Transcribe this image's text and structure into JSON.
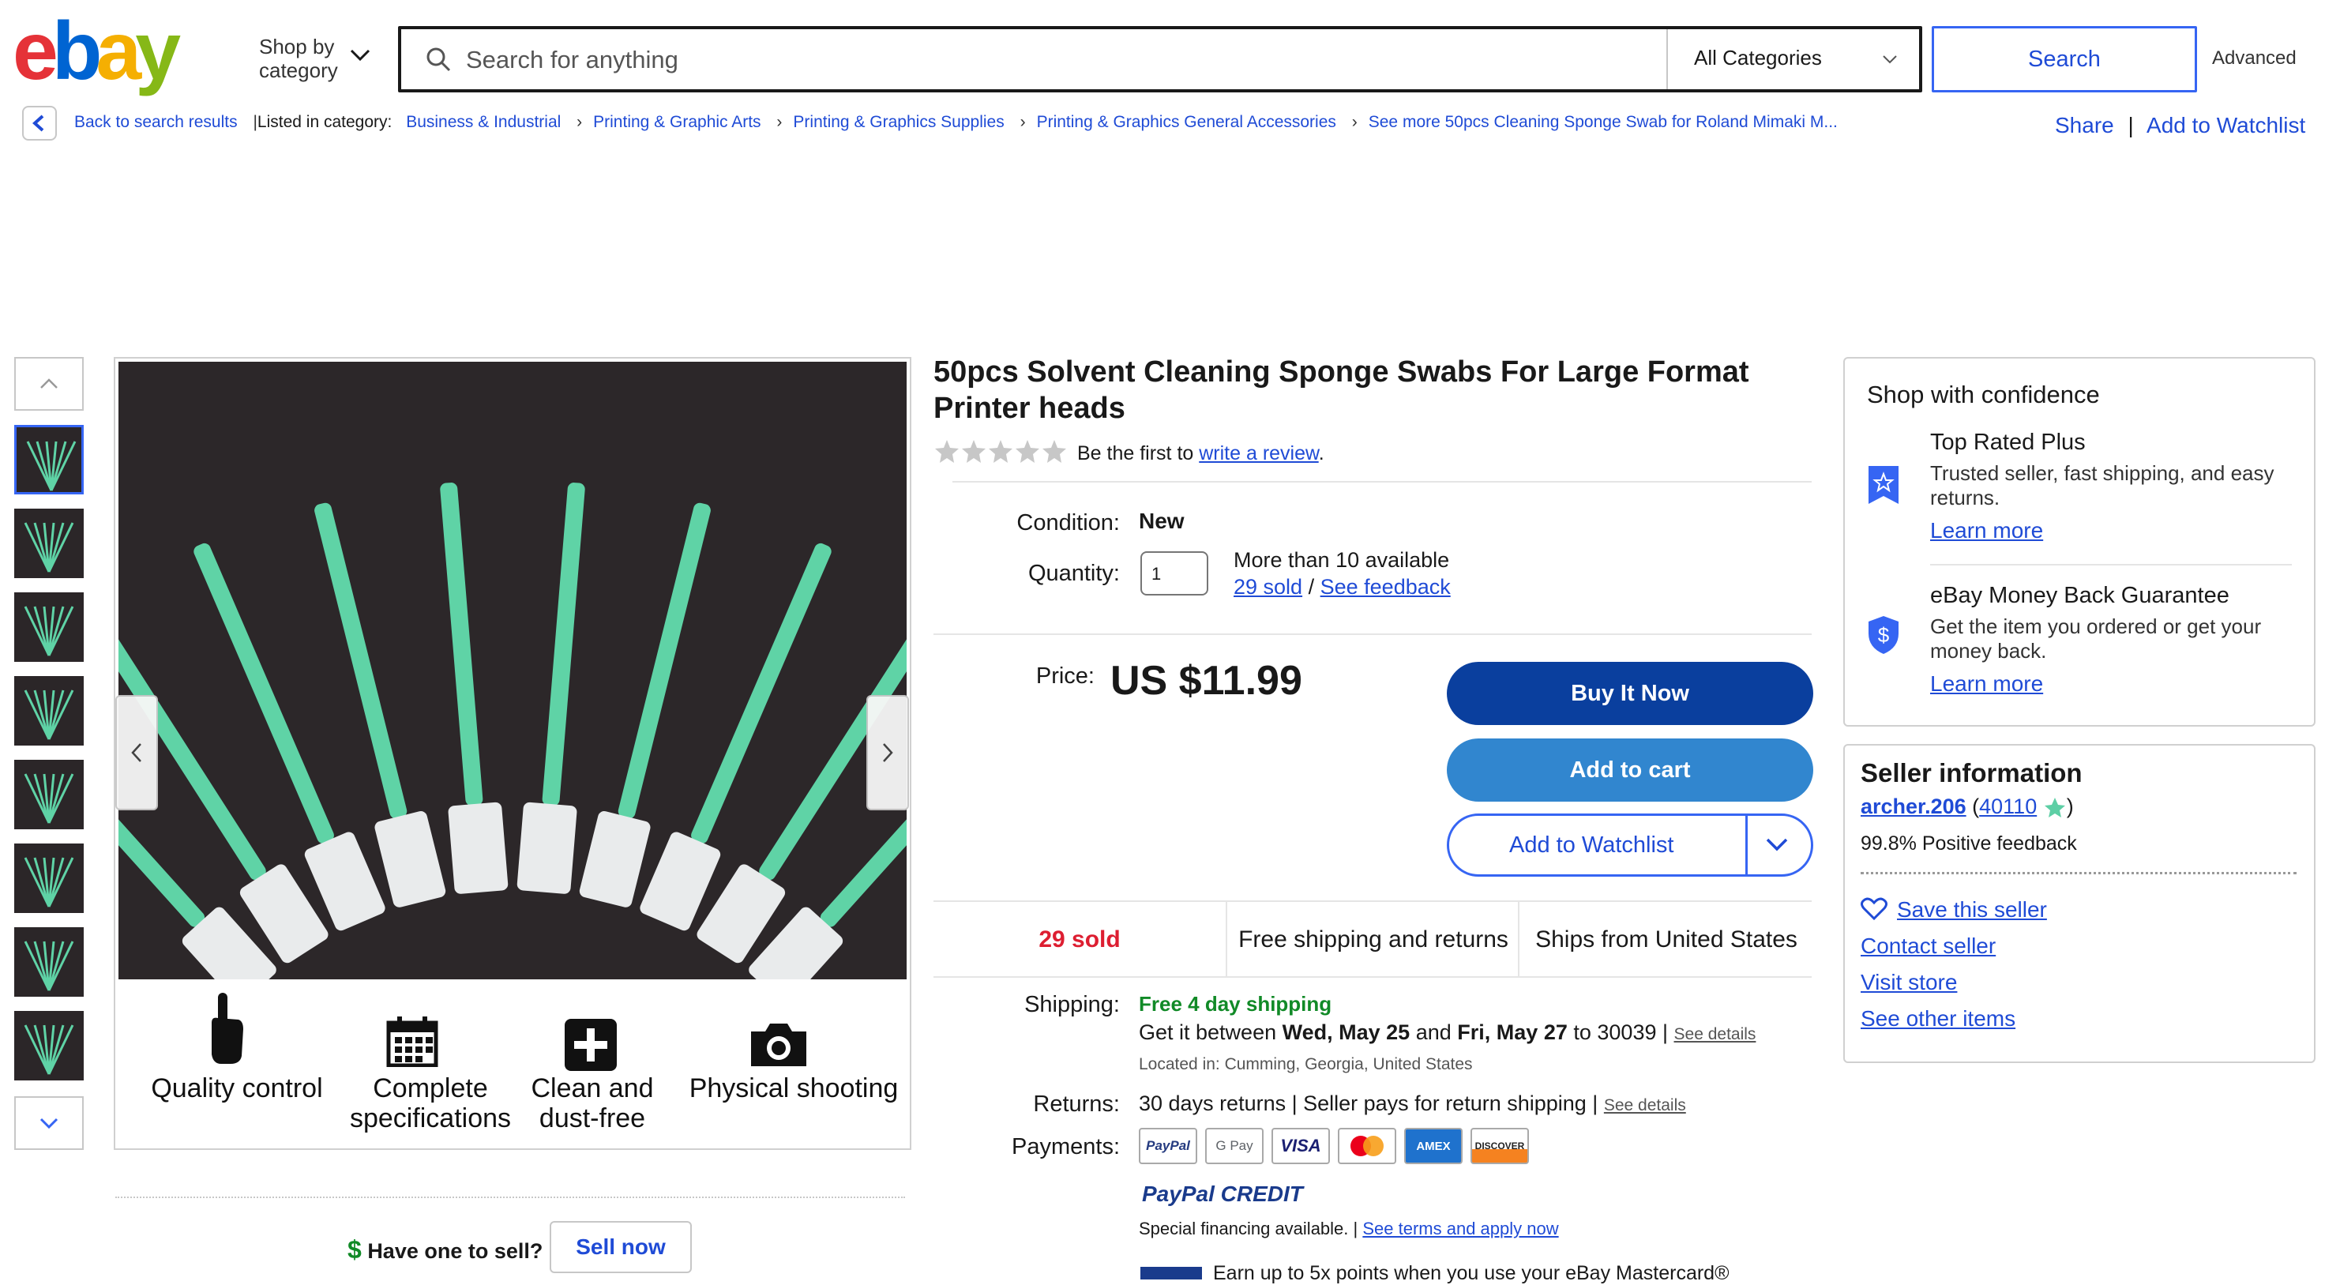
{
  "header": {
    "logo_text": "ebay",
    "shop_by_category": "Shop by category",
    "search_placeholder": "Search for anything",
    "category_select": "All Categories",
    "search_button": "Search",
    "advanced_link": "Advanced"
  },
  "breadcrumb": {
    "back": "Back to search results",
    "listed_in": "Listed in category:",
    "items": [
      "Business & Industrial",
      "Printing & Graphic Arts",
      "Printing & Graphics Supplies",
      "Printing & Graphics General Accessories",
      "See more 50pcs Cleaning Sponge Swab for Roland Mimaki M..."
    ],
    "share": "Share",
    "add_to_watchlist": "Add to Watchlist"
  },
  "gallery": {
    "thumbnail_count": 8,
    "selected_index": 0,
    "features": [
      "Quality control",
      "Complete specifications",
      "Clean and dust-free",
      "Physical shooting"
    ],
    "sell_question": "Have one to sell?",
    "sell_now": "Sell now"
  },
  "product": {
    "title": "50pcs Solvent Cleaning Sponge Swabs For Large Format Printer heads",
    "review_prompt": "Be the first to",
    "review_link": "write a review",
    "review_period": ".",
    "condition_label": "Condition:",
    "condition_value": "New",
    "quantity_label": "Quantity:",
    "quantity_value": "1",
    "availability": "More than 10 available",
    "sold_link": "29 sold",
    "slash": "/",
    "feedback_link": "See feedback",
    "price_label": "Price:",
    "price": "US $11.99",
    "buy_it_now": "Buy It Now",
    "add_to_cart": "Add to cart",
    "add_to_watchlist": "Add to Watchlist",
    "highlights": [
      "29 sold",
      "Free shipping and returns",
      "Ships from United States"
    ],
    "shipping_label": "Shipping:",
    "shipping_free": "Free 4 day shipping",
    "delivery_pre": "Get it between",
    "delivery_start": "Wed, May 25",
    "delivery_and": "and",
    "delivery_end": "Fri, May 27",
    "delivery_zip": "to 30039 |",
    "see_details": "See details",
    "located_in": "Located in: Cumming, Georgia, United States",
    "returns_label": "Returns:",
    "returns_value": "30 days returns | Seller pays for return shipping |",
    "payments_label": "Payments:",
    "payment_methods": [
      "PayPal",
      "G Pay",
      "VISA",
      "Mastercard",
      "AMEX",
      "DISCOVER"
    ],
    "paypal_credit": "PayPal CREDIT",
    "financing_text": "Special financing available. |",
    "financing_link": "See terms and apply now",
    "mastercard_promo": "Earn up to 5x points when you use your eBay Mastercard®"
  },
  "confidence": {
    "title": "Shop with confidence",
    "items": [
      {
        "heading": "Top Rated Plus",
        "text": "Trusted seller, fast shipping, and easy returns.",
        "link": "Learn more"
      },
      {
        "heading": "eBay Money Back Guarantee",
        "text": "Get the item you ordered or get your money back.",
        "link": "Learn more"
      }
    ]
  },
  "seller": {
    "title": "Seller information",
    "name": "archer.206",
    "feedback_score": "40110",
    "positive": "99.8% Positive feedback",
    "save_seller": "Save this seller",
    "contact": "Contact seller",
    "visit_store": "Visit store",
    "other_items": "See other items"
  },
  "colors": {
    "ebay_red": "#e53238",
    "ebay_blue": "#0064d2",
    "ebay_yellow": "#f5af02",
    "ebay_green": "#86b817",
    "link": "#1f4bd6",
    "buy_now": "#0a3f9e",
    "add_to_cart": "#3186cf",
    "sold_red": "#dd1e31",
    "free_green": "#118a27"
  }
}
